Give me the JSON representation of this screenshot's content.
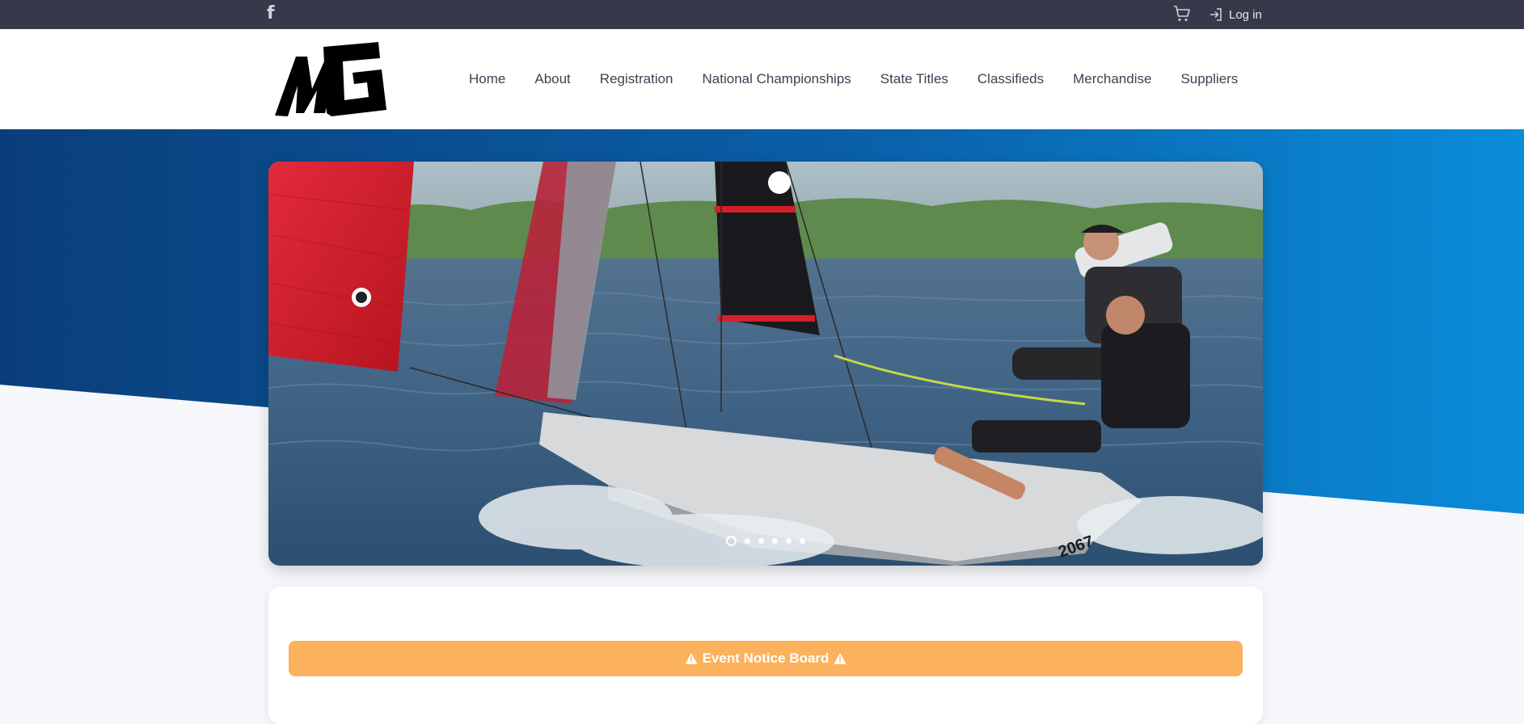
{
  "topbar": {
    "social_icon": "facebook-icon",
    "cart_icon": "cart-icon",
    "login_icon": "login-icon",
    "login_label": "Log in"
  },
  "header": {
    "logo_text": "MG",
    "nav": [
      {
        "label": "Home"
      },
      {
        "label": "About"
      },
      {
        "label": "Registration"
      },
      {
        "label": "National Championships"
      },
      {
        "label": "State Titles"
      },
      {
        "label": "Classifieds"
      },
      {
        "label": "Merchandise"
      },
      {
        "label": "Suppliers"
      }
    ]
  },
  "hero": {
    "slide_count": 6,
    "active_slide": 1,
    "sail_number": "2067"
  },
  "notice_board": {
    "label": "Event Notice Board",
    "icon": "warning-triangle-icon"
  },
  "colors": {
    "topbar": "#37394a",
    "band_dark": "#0a3e7a",
    "band_light": "#0a8cd8",
    "notice": "#fcb15c"
  }
}
